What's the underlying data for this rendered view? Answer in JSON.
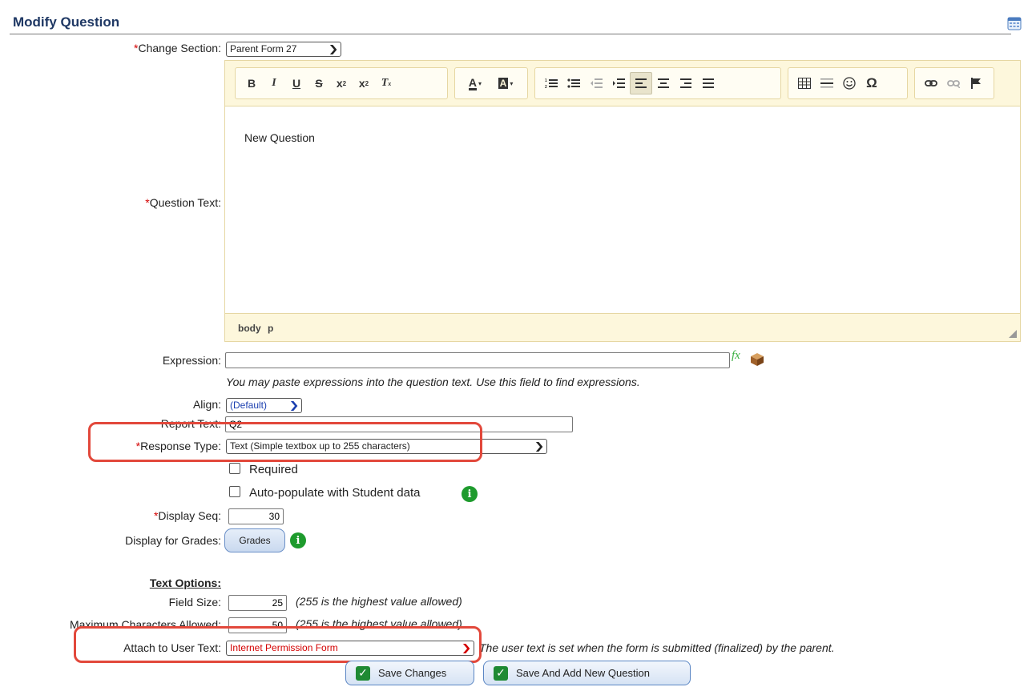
{
  "page": {
    "title": "Modify Question"
  },
  "form": {
    "change_section": {
      "label": "Change Section:",
      "value": "Parent Form 27"
    },
    "question_text": {
      "label": "Question Text:",
      "content": "New Question"
    },
    "editor": {
      "toolbar_icons": [
        "bold-icon",
        "italic-icon",
        "underline-icon",
        "strikethrough-icon",
        "subscript-icon",
        "superscript-icon",
        "remove-format-icon",
        "text-color-icon",
        "background-color-icon",
        "numbered-list-icon",
        "bulleted-list-icon",
        "decrease-indent-icon",
        "increase-indent-icon",
        "align-left-icon",
        "align-center-icon",
        "align-right-icon",
        "justify-icon",
        "table-icon",
        "horizontal-line-icon",
        "smiley-icon",
        "special-char-icon",
        "link-icon",
        "unlink-icon",
        "anchor-icon"
      ],
      "path": [
        "body",
        "p"
      ]
    },
    "expression": {
      "label": "Expression:",
      "value": "",
      "hint": "You may paste expressions into the question text. Use this field to find expressions."
    },
    "align": {
      "label": "Align:",
      "value": "(Default)"
    },
    "report_text": {
      "label": "Report Text:",
      "value": "Q2"
    },
    "response_type": {
      "label": "Response Type:",
      "value": "Text (Simple textbox up to 255 characters)"
    },
    "required": {
      "label": "Required",
      "checked": false
    },
    "auto_populate": {
      "label": "Auto-populate with Student data",
      "checked": false
    },
    "display_seq": {
      "label": "Display Seq:",
      "value": "30"
    },
    "display_for_grades": {
      "label": "Display for Grades:",
      "button": "Grades"
    },
    "text_options": {
      "heading": "Text Options:",
      "field_size": {
        "label": "Field Size:",
        "value": "25",
        "hint": "(255 is the highest value allowed)"
      },
      "max_chars": {
        "label": "Maximum Characters Allowed:",
        "value": "50",
        "hint": "(255 is the highest value allowed)"
      }
    },
    "attach_user_text": {
      "label": "Attach to User Text:",
      "value": "Internet Permission Form",
      "hint": "The user text is set when the form is submitted (finalized) by the parent."
    }
  },
  "buttons": {
    "save": "Save Changes",
    "save_add": "Save And Add New Question"
  },
  "required_marker": "*",
  "colors": {
    "required": "#d40000",
    "highlight": "#e2483b",
    "info": "#1e9b2d",
    "check": "#1f8a33"
  }
}
